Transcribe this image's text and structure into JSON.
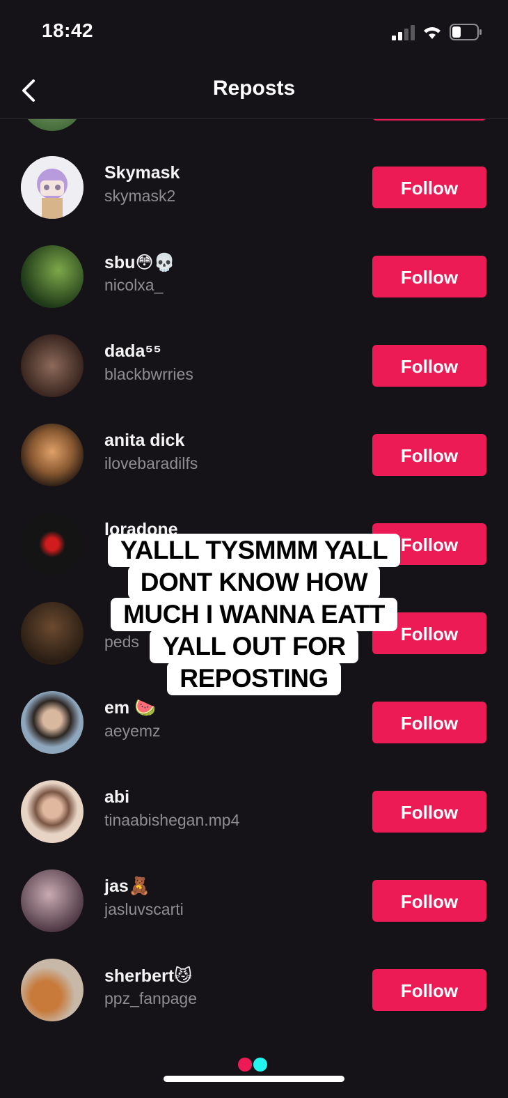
{
  "status_bar": {
    "time": "18:42"
  },
  "header": {
    "title": "Reposts"
  },
  "reposters": [
    {
      "display_name": "",
      "username": "",
      "avatar_colors": [
        "#2f5a2a",
        "#8aa670"
      ]
    },
    {
      "display_name": "Skymask",
      "username": "skymask2",
      "avatar_colors": [
        "#d9d3e8",
        "#a68ad1"
      ]
    },
    {
      "display_name": "sbu😳💀",
      "username": "nicolxa_",
      "avatar_colors": [
        "#1f3a18",
        "#7da84a"
      ]
    },
    {
      "display_name": "dada⁵⁵",
      "username": "blackbwrries",
      "avatar_colors": [
        "#3a2620",
        "#8c6a5a"
      ]
    },
    {
      "display_name": "anita dick",
      "username": "ilovebaradilfs",
      "avatar_colors": [
        "#2a1d14",
        "#e0a069"
      ]
    },
    {
      "display_name": "loradone",
      "username": "",
      "avatar_colors": [
        "#141414",
        "#d01c1c"
      ]
    },
    {
      "display_name": "",
      "username": "peds",
      "avatar_colors": [
        "#2a1e14",
        "#6b4a30"
      ]
    },
    {
      "display_name": "em 🍉",
      "username": "aeyemz",
      "avatar_colors": [
        "#8fa7bd",
        "#2d2722"
      ]
    },
    {
      "display_name": "abi",
      "username": "tinaabishegan.mp4",
      "avatar_colors": [
        "#e8d4c4",
        "#7a5544"
      ]
    },
    {
      "display_name": "jas🧸",
      "username": "jasluvscarti",
      "avatar_colors": [
        "#c9aab2",
        "#4a3540"
      ]
    },
    {
      "display_name": "sherbert😼",
      "username": "ppz_fanpage",
      "avatar_colors": [
        "#c8b8a8",
        "#c87a3a"
      ]
    }
  ],
  "follow_label": "Follow",
  "caption": {
    "lines": [
      "YALLL TYSMMM YALL",
      "DONT KNOW HOW",
      "MUCH I WANNA EATT",
      "YALL OUT FOR",
      "REPOSTING"
    ]
  },
  "colors": {
    "background": "#161318",
    "follow_button": "#ec1a55",
    "secondary_text": "#8f8c92",
    "dot_left": "#ec1a55",
    "dot_right": "#25f4ee"
  }
}
